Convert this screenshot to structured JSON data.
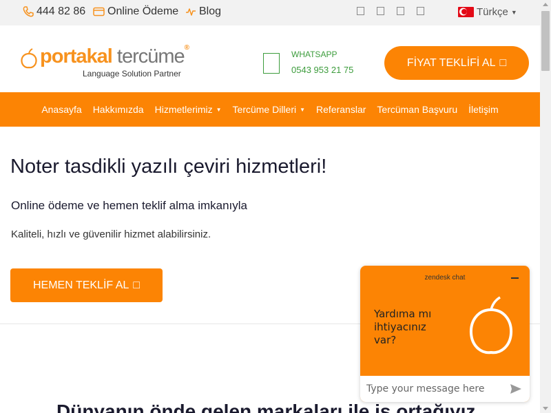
{
  "topbar": {
    "phone": "444 82 86",
    "online_payment": "Online Ödeme",
    "blog": "Blog",
    "language": "Türkçe",
    "social_icons": [
      "social-icon-1",
      "social-icon-2",
      "social-icon-3",
      "social-icon-4"
    ]
  },
  "header": {
    "logo_part1": "portakal",
    "logo_part2": "tercüme",
    "logo_registered": "®",
    "tagline": "Language Solution Partner",
    "whatsapp_label": "WHATSAPP",
    "whatsapp_number": "0543 953 21 75",
    "quote_button": "FİYAT TEKLİFİ AL",
    "quote_icon": "□"
  },
  "nav": {
    "items": [
      {
        "label": "Anasayfa"
      },
      {
        "label": "Hakkımızda"
      },
      {
        "label": "Hizmetlerimiz",
        "dropdown": true
      },
      {
        "label": "Tercüme Dilleri",
        "dropdown": true
      },
      {
        "label": "Referanslar"
      },
      {
        "label": "Tercüman Başvuru"
      },
      {
        "label": "İletişim"
      }
    ]
  },
  "hero": {
    "title": "Noter tasdikli yazılı çeviri hizmetleri!",
    "subtitle": "Online ödeme ve hemen teklif alma imkanıyla",
    "text": "Kaliteli, hızlı ve güvenilir hizmet alabilirsiniz.",
    "button": "HEMEN TEKLİF AL",
    "button_icon": "□",
    "next_heading": "Dünyanın önde gelen markaları ile iş ortağıyız"
  },
  "chat": {
    "brand": "zendesk chat",
    "message": "Yardıma mı ihtiyacınız var?",
    "input_placeholder": "Type your message here"
  },
  "colors": {
    "accent": "#fc8404",
    "whatsapp": "#3c9c3c",
    "topbar_bg": "#f2f2f2"
  }
}
